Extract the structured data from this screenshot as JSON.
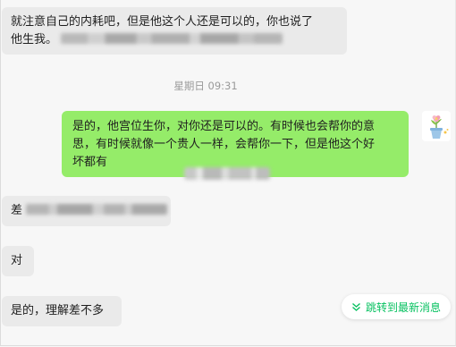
{
  "chat": {
    "messages": [
      {
        "side": "left",
        "line1": "就注意自己的内耗吧，但是他这个人还是可以的，你也说了",
        "line2_prefix": "他生我。"
      },
      {
        "side": "right",
        "lines": [
          "是的，他宫位生你，对你还是可以的。有时候也会帮你的意",
          "思，有时候就像一个贵人一样，会帮你一下，但是他这个好",
          "坏都有"
        ]
      },
      {
        "side": "left",
        "prefix": "差"
      },
      {
        "side": "left",
        "text": "对"
      },
      {
        "side": "left",
        "text": "是的，理解差不多"
      }
    ],
    "timestamp": "星期日 09:31",
    "jump_to_latest": "跳转到最新消息"
  },
  "colors": {
    "incoming_bubble": "#eaeaea",
    "outgoing_bubble": "#95ec69",
    "accent": "#07c160",
    "timestamp_text": "#9a9a9a"
  },
  "icons": {
    "avatar": "flower-pot-avatar-icon",
    "jump": "double-chevron-down-icon"
  }
}
